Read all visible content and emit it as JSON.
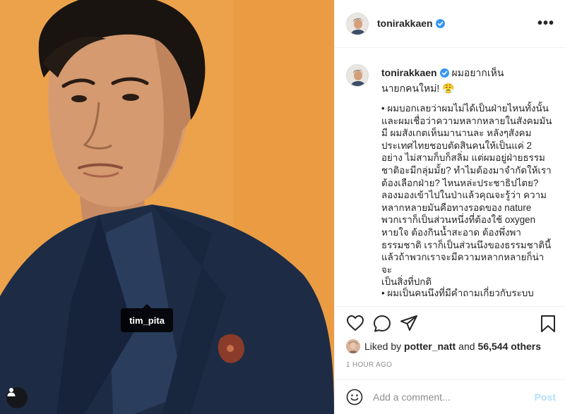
{
  "photo": {
    "tagged_user": "tim_pita",
    "background_color": "#eca24b"
  },
  "header": {
    "username": "tonirakkaen",
    "verified": true,
    "more_label": "•••"
  },
  "caption": {
    "username": "tonirakkaen",
    "headline": "ผมอยากเห็นนายกคนใหม่! 😤",
    "paragraph1": "• ผมบอกเลยว่าผมไม่ได้เป็นฝ่ายไหนทั้งนั้น\nและผมเชื่อว่าความหลากหลายในสังคมมัน\nมี ผมสังเกตเห็นมานานละ หลังๆสังคม\nประเทศไทยชอบตัดสินคนให้เป็นแค่ 2\nอย่าง ไม่สามก็บก็สลิ่ม แต่ผมอยู่ฝ่ายธรรม\nชาติอะมีกลุ่มมั้ย? ทำไมต้องมาจำกัดให้เรา\nต้องเลือกฝ่าย? ไหนหล่ะประชาธิปไตย?\nลองมองเข้าไปในป่าแล้วคุณจะรู้ว่า ความ\nหลากหลายมันคือทางรอดของ nature\nพวกเราก็เป็นส่วนหนึ่งที่ต้องใช้ oxygen\nหายใจ ต้องกินน้ำสะอาด ต้องพึ่งพา\nธรรมชาติ เราก็เป็นส่วนนึงของธรรมชาตินี้\nแล้วถ้าพวกเราจะมีความหลากหลายก็น่าจะ\nเป็นสิ่งที่ปกติ",
    "paragraph2": "• ผมเป็นคนนึงที่มีคำถามเกี่ยวกับระบบ"
  },
  "likes": {
    "prefix": "Liked by",
    "user": "potter_natt",
    "connector": "and",
    "count": "56,544 others"
  },
  "timestamp": "1 HOUR AGO",
  "comment_box": {
    "placeholder": "Add a comment...",
    "post_label": "Post"
  },
  "colors": {
    "verified_blue": "#3897f0",
    "muted_text": "#8e8e8e",
    "post_disabled": "#b2dffc"
  },
  "icons": [
    "heart-icon",
    "comment-icon",
    "share-icon",
    "bookmark-icon",
    "emoji-icon",
    "user-tag-icon",
    "verified-badge-icon",
    "more-options-icon"
  ]
}
